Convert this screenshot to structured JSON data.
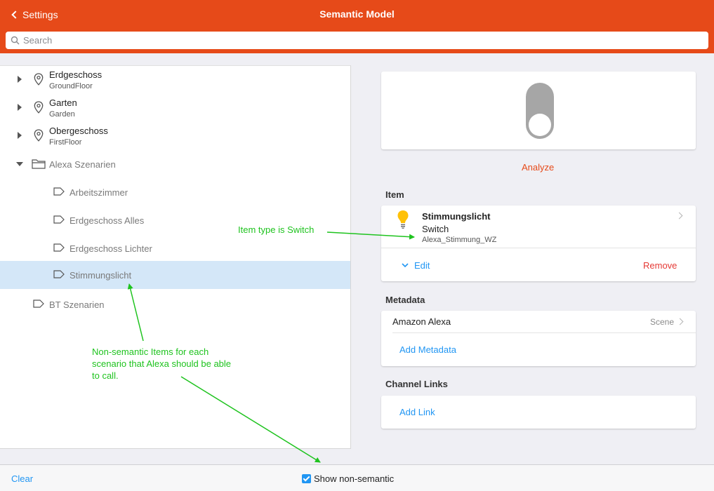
{
  "header": {
    "back_label": "Settings",
    "title": "Semantic Model"
  },
  "search": {
    "placeholder": "Search"
  },
  "tree": {
    "nodes": [
      {
        "title": "Erdgeschoss",
        "subtitle": "GroundFloor"
      },
      {
        "title": "Garten",
        "subtitle": "Garden"
      },
      {
        "title": "Obergeschoss",
        "subtitle": "FirstFloor"
      },
      {
        "title": "Alexa Szenarien"
      },
      {
        "title": "Arbeitszimmer"
      },
      {
        "title": "Erdgeschoss Alles"
      },
      {
        "title": "Erdgeschoss Lichter"
      },
      {
        "title": "Stimmungslicht"
      },
      {
        "title": "BT Szenarien"
      }
    ]
  },
  "details": {
    "analyze_label": "Analyze",
    "item_section_title": "Item",
    "item": {
      "name": "Stimmungslicht",
      "type": "Switch",
      "id": "Alexa_Stimmung_WZ",
      "edit_label": "Edit",
      "remove_label": "Remove"
    },
    "metadata_section_title": "Metadata",
    "metadata": {
      "namespace": "Amazon Alexa",
      "value": "Scene",
      "add_label": "Add Metadata"
    },
    "channel_section_title": "Channel Links",
    "channel": {
      "add_label": "Add Link"
    }
  },
  "toolbar": {
    "clear_label": "Clear",
    "show_nonsemantic_label": "Show non-semantic",
    "show_nonsemantic_checked": true
  },
  "annotations": {
    "item_type_note": "Item type is Switch",
    "nonsemantic_note": "Non-semantic Items for each scenario that Alexa should be able to call."
  },
  "colors": {
    "accent": "#e64a19",
    "link": "#2196f3",
    "remove": "#e53935",
    "selected_row": "#d4e7f8",
    "annotation": "#1ec31e",
    "bulb": "#ffc107"
  }
}
